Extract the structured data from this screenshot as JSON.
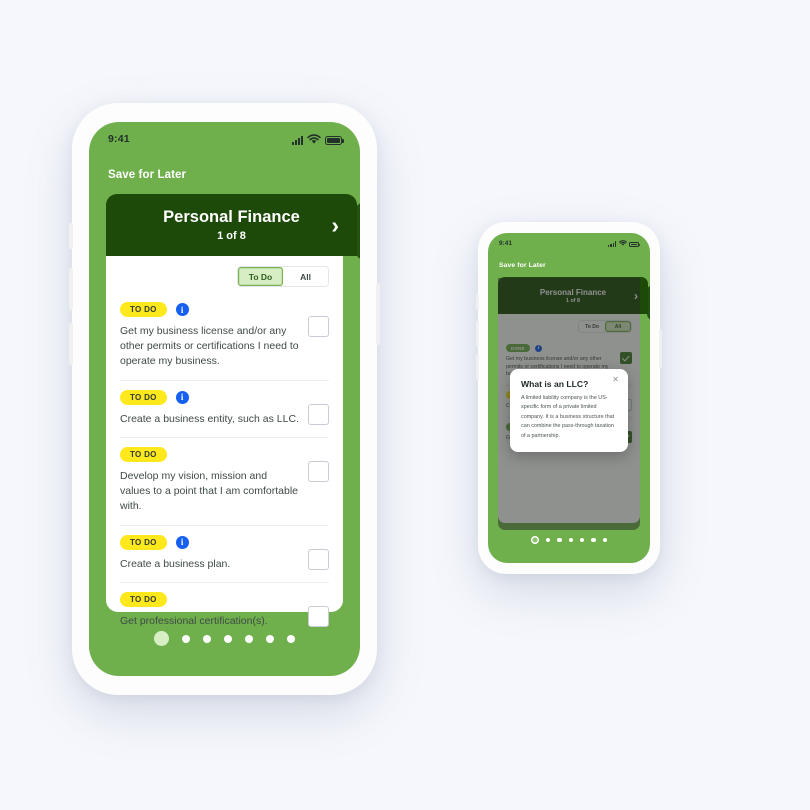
{
  "theme": {
    "page_bg": "#f5f7fc",
    "brand_green": "#6fb04d",
    "dark_green": "#1e4a09",
    "badge_yellow": "#ffe81c",
    "info_blue": "#1560f0",
    "check_green": "#3f7a26"
  },
  "phone_large": {
    "status": {
      "time": "9:41",
      "signal_icon": "cellular-bars-icon",
      "wifi_icon": "wifi-icon",
      "battery_icon": "battery-full-icon"
    },
    "app_title": "Save for Later",
    "category": {
      "name": "Personal Finance",
      "counter": "1 of 8",
      "chevron": "›"
    },
    "segmented": {
      "options": [
        "To Do",
        "All"
      ],
      "selected": "To Do"
    },
    "tasks": [
      {
        "badge": "TO DO",
        "badge_type": "todo",
        "has_info": true,
        "text": "Get my business license and/or any other permits or certifications I need to operate my business.",
        "checked": false
      },
      {
        "badge": "TO DO",
        "badge_type": "todo",
        "has_info": true,
        "text": "Create a business entity, such as LLC.",
        "checked": false
      },
      {
        "badge": "TO DO",
        "badge_type": "todo",
        "has_info": false,
        "text": "Develop my vision, mission and values to a point that I am comfortable with.",
        "checked": false
      },
      {
        "badge": "TO DO",
        "badge_type": "todo",
        "has_info": true,
        "text": "Create a business plan.",
        "checked": false
      },
      {
        "badge": "TO DO",
        "badge_type": "todo",
        "has_info": false,
        "text": "Get professional certification(s).",
        "checked": false
      }
    ],
    "pagination": {
      "count": 7,
      "active_index": 0
    }
  },
  "phone_small": {
    "status": {
      "time": "9:41",
      "signal_icon": "cellular-bars-icon",
      "wifi_icon": "wifi-icon",
      "battery_icon": "battery-full-icon"
    },
    "app_title": "Save for Later",
    "category": {
      "name": "Personal Finance",
      "counter": "1 of 8",
      "chevron": "›"
    },
    "segmented": {
      "options": [
        "To Do",
        "All"
      ],
      "selected": "All"
    },
    "tasks": [
      {
        "badge": "DONE",
        "badge_type": "done",
        "has_info": true,
        "text": "Get my business license and/or any other permits or certifications I need to operate my business.",
        "checked": true
      },
      {
        "badge": "TO DO",
        "badge_type": "todo",
        "has_info": true,
        "text": "Create a business plan.",
        "checked": false
      },
      {
        "badge": "DONE",
        "badge_type": "done",
        "has_info": false,
        "text": "Get professional certification(s).",
        "checked": true
      }
    ],
    "modal": {
      "title": "What is an LLC?",
      "body": "A limited liability company is the US-specific form of a private limited company. It is a business structure that can combine the pass-through taxation of a partnership.",
      "close_label": "✕"
    },
    "pagination": {
      "count": 7,
      "active_index": 0
    }
  }
}
